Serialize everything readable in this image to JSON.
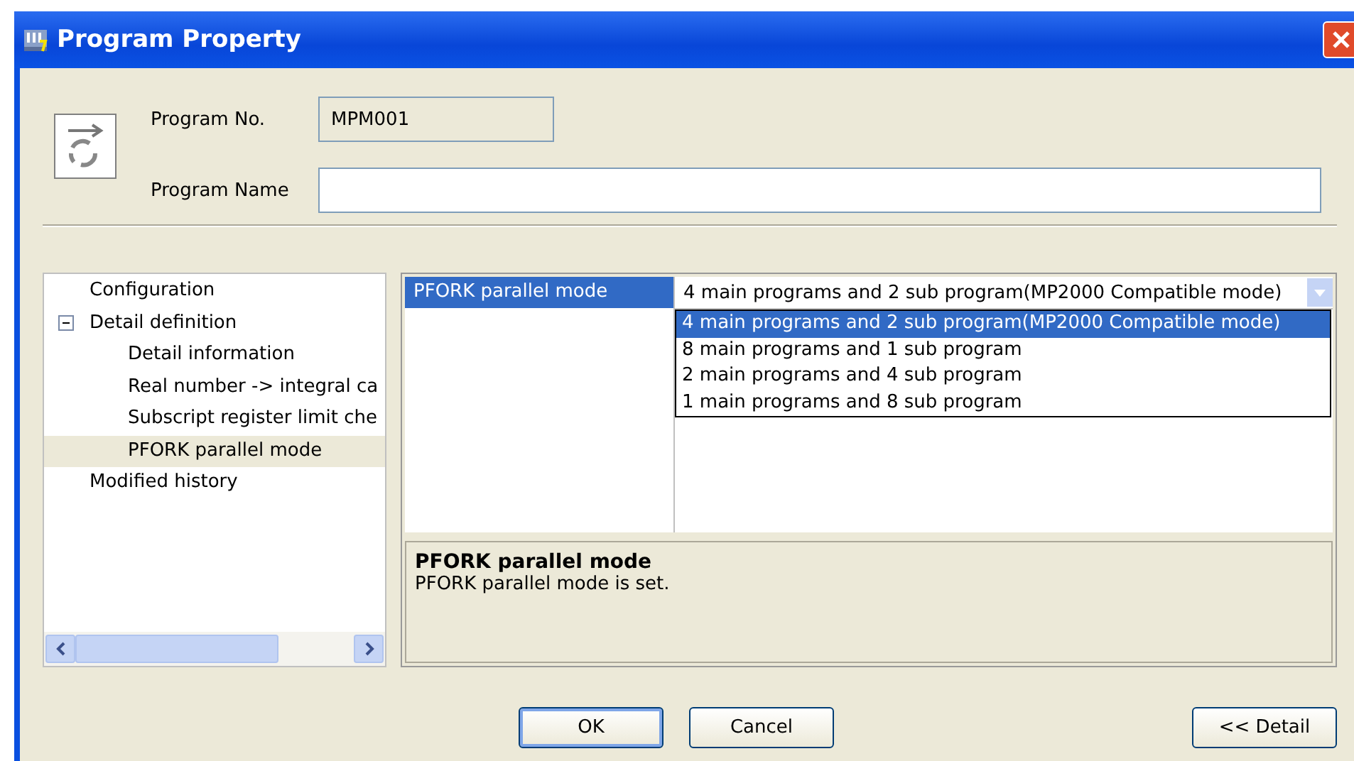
{
  "window": {
    "title": "Program Property"
  },
  "program_no": {
    "label": "Program No.",
    "value": "MPM001"
  },
  "program_name": {
    "label": "Program Name"
  },
  "tree": [
    {
      "label": "Configuration",
      "selected": false
    },
    {
      "label": "Detail definition",
      "selected": false,
      "expanded": true,
      "children": [
        {
          "label": "Detail information",
          "selected": false
        },
        {
          "label": "Real number -> integral ca",
          "selected": false
        },
        {
          "label": "Subscript register limit che",
          "selected": false
        },
        {
          "label": "PFORK parallel mode",
          "selected": true
        }
      ]
    },
    {
      "label": "Modified history",
      "selected": false
    }
  ],
  "property": {
    "name": "PFORK parallel mode",
    "selected": true,
    "value": "4 main programs and 2 sub program(MP2000 Compatible mode)",
    "options": [
      {
        "label": "4 main programs and 2 sub program(MP2000 Compatible mode)",
        "selected": true
      },
      {
        "label": "8 main programs and 1 sub program",
        "selected": false
      },
      {
        "label": "2 main programs and 4 sub program",
        "selected": false
      },
      {
        "label": "1 main programs and 8 sub program",
        "selected": false
      }
    ]
  },
  "description": {
    "title": "PFORK parallel mode",
    "text": "PFORK parallel mode is set."
  },
  "buttons": [
    {
      "label": "OK",
      "kind": "default"
    },
    {
      "label": "Cancel",
      "kind": "normal"
    },
    {
      "label": "<< Detail",
      "kind": "normal"
    }
  ]
}
